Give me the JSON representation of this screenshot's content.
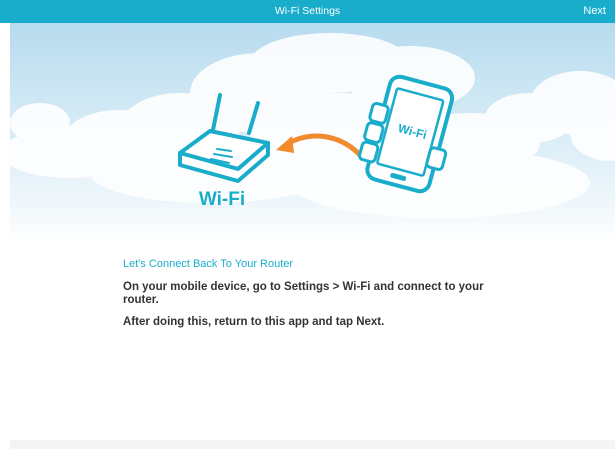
{
  "header": {
    "title": "Wi-Fi Settings",
    "next_label": "Next"
  },
  "hero": {
    "router_label": "Wi-Fi",
    "phone_label": "Wi-Fi"
  },
  "instructions": {
    "subtitle": "Let's Connect Back To Your Router",
    "step1": "On your mobile device, go to Settings > Wi-Fi and connect to your router.",
    "step2": "After doing this, return to this app and tap Next."
  },
  "colors": {
    "accent": "#1aaccb",
    "arrow": "#f28a2e",
    "text": "#333333"
  },
  "icons": [
    "router-icon",
    "arrow-icon",
    "phone-icon"
  ]
}
